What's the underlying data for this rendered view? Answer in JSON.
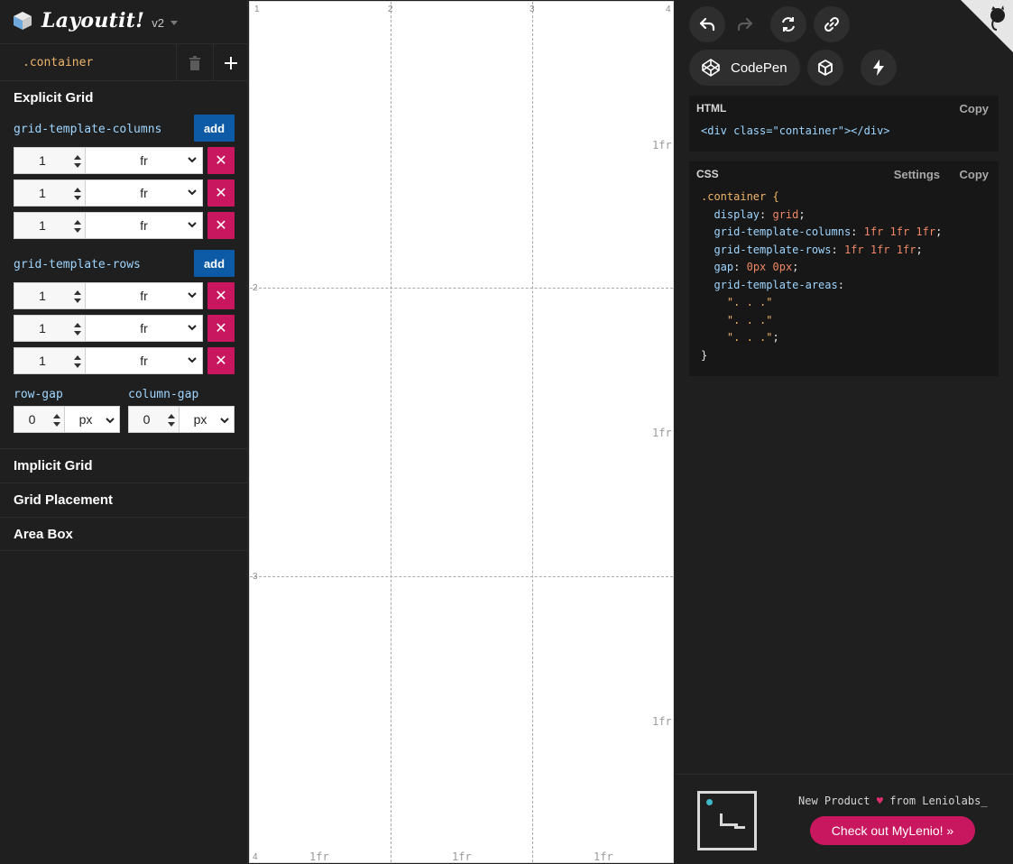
{
  "app": {
    "name": "Layoutit!",
    "version": "v2"
  },
  "selector": {
    "name": ".container"
  },
  "explicit_grid": {
    "title": "Explicit Grid",
    "columns_label": "grid-template-columns",
    "rows_label": "grid-template-rows",
    "add_label": "add",
    "delete_glyph": "✕",
    "columns": [
      {
        "value": "1",
        "unit": "fr"
      },
      {
        "value": "1",
        "unit": "fr"
      },
      {
        "value": "1",
        "unit": "fr"
      }
    ],
    "rows": [
      {
        "value": "1",
        "unit": "fr"
      },
      {
        "value": "1",
        "unit": "fr"
      },
      {
        "value": "1",
        "unit": "fr"
      }
    ],
    "row_gap": {
      "label": "row-gap",
      "value": "0",
      "unit": "px"
    },
    "column_gap": {
      "label": "column-gap",
      "value": "0",
      "unit": "px"
    }
  },
  "sections": [
    "Implicit Grid",
    "Grid Placement",
    "Area Box"
  ],
  "canvas": {
    "col_line_numbers": [
      "1",
      "2",
      "3",
      "4"
    ],
    "row_line_numbers": [
      "2",
      "3",
      "4"
    ],
    "col_sizes": [
      "1fr",
      "1fr",
      "1fr"
    ],
    "row_sizes": [
      "1fr",
      "1fr",
      "1fr"
    ]
  },
  "toolbar": {
    "undo": "undo-icon",
    "redo": "redo-icon",
    "reset": "reset-icon",
    "link": "link-icon",
    "codepen_label": "CodePen",
    "codesandbox": "codesandbox-icon",
    "stackblitz": "lightning-icon"
  },
  "html_code": {
    "title": "HTML",
    "copy_label": "Copy",
    "open": "<div class=\"container\"></div>"
  },
  "css_code": {
    "title": "CSS",
    "settings_label": "Settings",
    "copy_label": "Copy",
    "selector": ".container {",
    "display_prop": "display",
    "display_val": "grid",
    "cols_prop": "grid-template-columns",
    "cols_val": "1fr 1fr 1fr",
    "rows_prop": "grid-template-rows",
    "rows_val": "1fr 1fr 1fr",
    "gap_prop": "gap",
    "gap_val": "0px 0px",
    "areas_prop": "grid-template-areas",
    "area_line_1": "\". . .\"",
    "area_line_2": "\". . .\"",
    "area_line_3": "\". . .\"",
    "close": "}"
  },
  "promo": {
    "text_prefix": "New Product",
    "heart": "♥",
    "text_suffix": "from Leniolabs_",
    "button_label": "Check out MyLenio! »"
  },
  "colors": {
    "accent_blue": "#0d5aa7",
    "accent_pink": "#c8175e",
    "bg": "#1f1f1f"
  }
}
